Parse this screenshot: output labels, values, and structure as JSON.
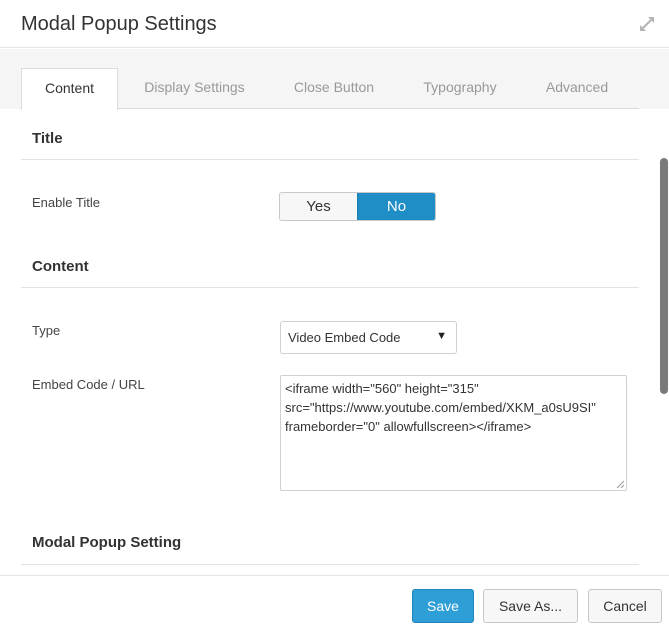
{
  "header": {
    "title": "Modal Popup Settings",
    "expand_icon": "expand-arrows-icon"
  },
  "tabs": [
    {
      "label": "Content",
      "active": true
    },
    {
      "label": "Display Settings",
      "active": false
    },
    {
      "label": "Close Button",
      "active": false
    },
    {
      "label": "Typography",
      "active": false
    },
    {
      "label": "Advanced",
      "active": false
    }
  ],
  "sections": {
    "title": {
      "heading": "Title",
      "enable_title": {
        "label": "Enable Title",
        "options": [
          "Yes",
          "No"
        ],
        "selected": "No"
      }
    },
    "content": {
      "heading": "Content",
      "type": {
        "label": "Type",
        "value": "Video Embed Code"
      },
      "embed": {
        "label": "Embed Code / URL",
        "lines": [
          "<iframe width=\"560\" height=\"315\"",
          "src=\"https://www.youtube.com/embed/XKM_a0sU9SI\"",
          "frameborder=\"0\" allowfullscreen></iframe>"
        ]
      }
    },
    "modal_popup_setting": {
      "heading": "Modal Popup Setting"
    }
  },
  "footer": {
    "save_label": "Save",
    "save_as_label": "Save As...",
    "cancel_label": "Cancel"
  },
  "colors": {
    "accent": "#1f8dc6",
    "save_button": "#2e9fd6"
  }
}
